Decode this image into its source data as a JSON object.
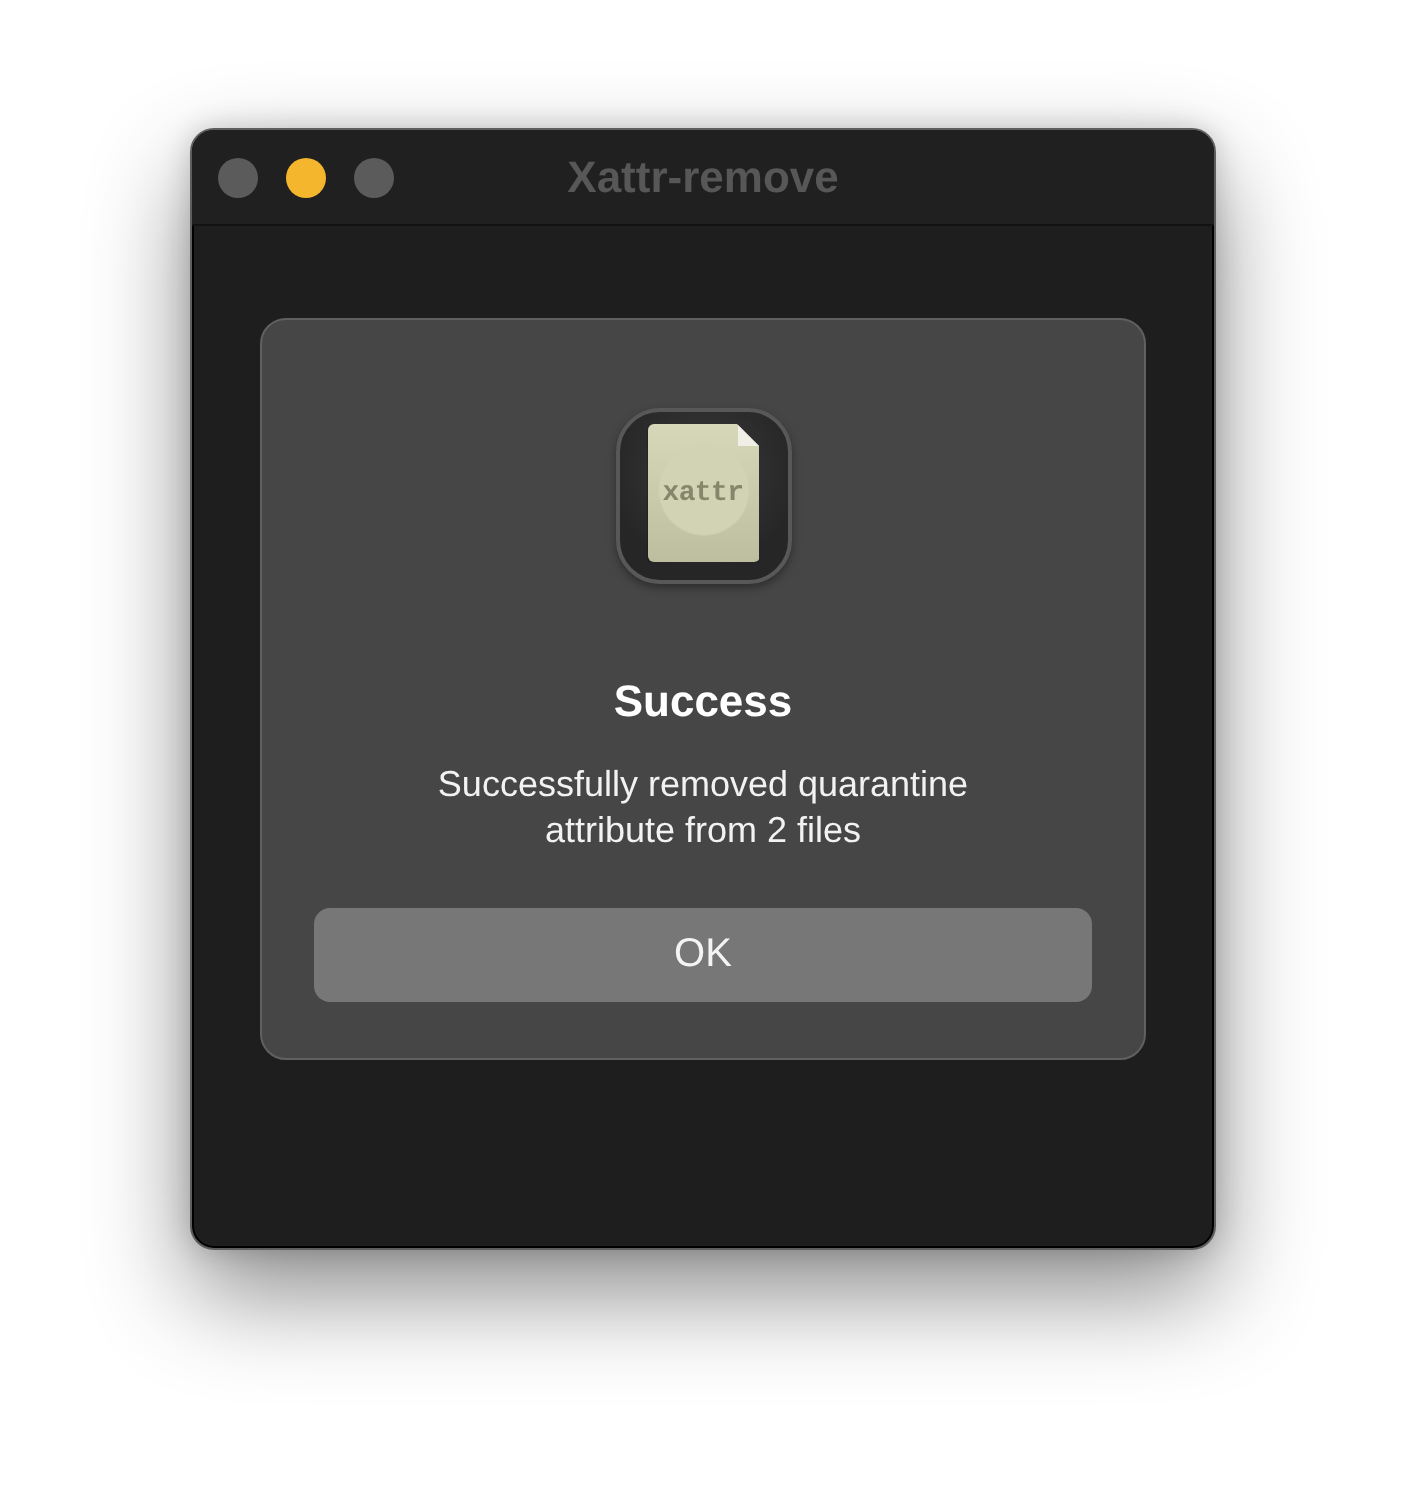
{
  "window": {
    "title": "Xattr-remove",
    "controls": [
      {
        "kind": "close",
        "color": "#5b5b5b"
      },
      {
        "kind": "minimize",
        "color": "#f4b62c"
      },
      {
        "kind": "zoom",
        "color": "#5b5b5b"
      }
    ]
  },
  "alert": {
    "icon_label": "xattr",
    "title": "Success",
    "message": "Successfully removed quarantine attribute from 2 files",
    "buttons": [
      {
        "label": "OK"
      }
    ]
  }
}
